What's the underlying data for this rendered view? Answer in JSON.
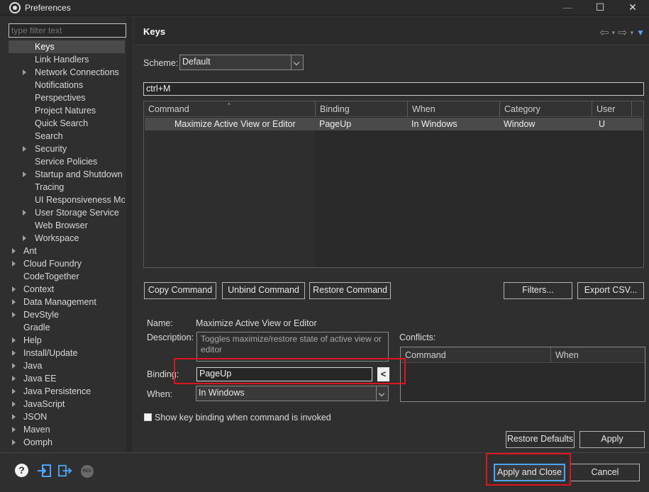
{
  "window": {
    "title": "Preferences",
    "minimize": "—",
    "maximize": "☐",
    "close": "✕"
  },
  "filter": {
    "placeholder": "type filter text"
  },
  "tree": {
    "items": [
      {
        "label": "Keys",
        "level": 1,
        "expandable": false,
        "selected": true
      },
      {
        "label": "Link Handlers",
        "level": 1,
        "expandable": false
      },
      {
        "label": "Network Connections",
        "level": 1,
        "expandable": true
      },
      {
        "label": "Notifications",
        "level": 1,
        "expandable": false
      },
      {
        "label": "Perspectives",
        "level": 1,
        "expandable": false
      },
      {
        "label": "Project Natures",
        "level": 1,
        "expandable": false
      },
      {
        "label": "Quick Search",
        "level": 1,
        "expandable": false
      },
      {
        "label": "Search",
        "level": 1,
        "expandable": false
      },
      {
        "label": "Security",
        "level": 1,
        "expandable": true
      },
      {
        "label": "Service Policies",
        "level": 1,
        "expandable": false
      },
      {
        "label": "Startup and Shutdown",
        "level": 1,
        "expandable": true
      },
      {
        "label": "Tracing",
        "level": 1,
        "expandable": false
      },
      {
        "label": "UI Responsiveness Mor",
        "level": 1,
        "expandable": false
      },
      {
        "label": "User Storage Service",
        "level": 1,
        "expandable": true
      },
      {
        "label": "Web Browser",
        "level": 1,
        "expandable": false
      },
      {
        "label": "Workspace",
        "level": 1,
        "expandable": true
      },
      {
        "label": "Ant",
        "level": 0,
        "expandable": true
      },
      {
        "label": "Cloud Foundry",
        "level": 0,
        "expandable": true
      },
      {
        "label": "CodeTogether",
        "level": 0,
        "expandable": false
      },
      {
        "label": "Context",
        "level": 0,
        "expandable": true
      },
      {
        "label": "Data Management",
        "level": 0,
        "expandable": true
      },
      {
        "label": "DevStyle",
        "level": 0,
        "expandable": true
      },
      {
        "label": "Gradle",
        "level": 0,
        "expandable": false
      },
      {
        "label": "Help",
        "level": 0,
        "expandable": true
      },
      {
        "label": "Install/Update",
        "level": 0,
        "expandable": true
      },
      {
        "label": "Java",
        "level": 0,
        "expandable": true
      },
      {
        "label": "Java EE",
        "level": 0,
        "expandable": true
      },
      {
        "label": "Java Persistence",
        "level": 0,
        "expandable": true
      },
      {
        "label": "JavaScript",
        "level": 0,
        "expandable": true
      },
      {
        "label": "JSON",
        "level": 0,
        "expandable": true
      },
      {
        "label": "Maven",
        "level": 0,
        "expandable": true
      },
      {
        "label": "Oomph",
        "level": 0,
        "expandable": true
      }
    ]
  },
  "page": {
    "title": "Keys",
    "nav_back": "⇦",
    "nav_forward": "⇨",
    "nav_menu": "▼",
    "nav_small": "▾"
  },
  "scheme": {
    "label": "Scheme:",
    "value": "Default"
  },
  "search": {
    "value": "ctrl+M"
  },
  "table": {
    "columns": [
      "Command",
      "Binding",
      "When",
      "Category",
      "User"
    ],
    "sort_indicator": "^",
    "rows": [
      {
        "command": "Maximize Active View or Editor",
        "binding": "PageUp",
        "when": "In Windows",
        "category": "Window",
        "user": "U"
      }
    ]
  },
  "actions": {
    "copy_command": "Copy Command",
    "unbind_command": "Unbind Command",
    "restore_command": "Restore Command",
    "filters": "Filters...",
    "export_csv": "Export CSV..."
  },
  "details": {
    "name_label": "Name:",
    "name_value": "Maximize Active View or Editor",
    "description_label": "Description:",
    "description_value": "Toggles maximize/restore state of active view or editor",
    "binding_label": "Binding:",
    "binding_value": "PageUp",
    "binding_side_btn": "<",
    "when_label": "When:",
    "when_value": "In Windows",
    "conflicts_label": "Conflicts:",
    "conflicts_columns": [
      "Command",
      "When"
    ],
    "show_binding_checkbox": "Show key binding when command is invoked"
  },
  "footer": {
    "restore_defaults": "Restore Defaults",
    "apply": "Apply",
    "apply_and_close": "Apply and Close",
    "cancel": "Cancel",
    "help_glyph": "?",
    "rec_label": "REC"
  },
  "colors": {
    "accent": "#4ea3ff",
    "highlight_box": "#e0141e",
    "selection": "#4a4a4a",
    "background": "#2f2f2f"
  }
}
